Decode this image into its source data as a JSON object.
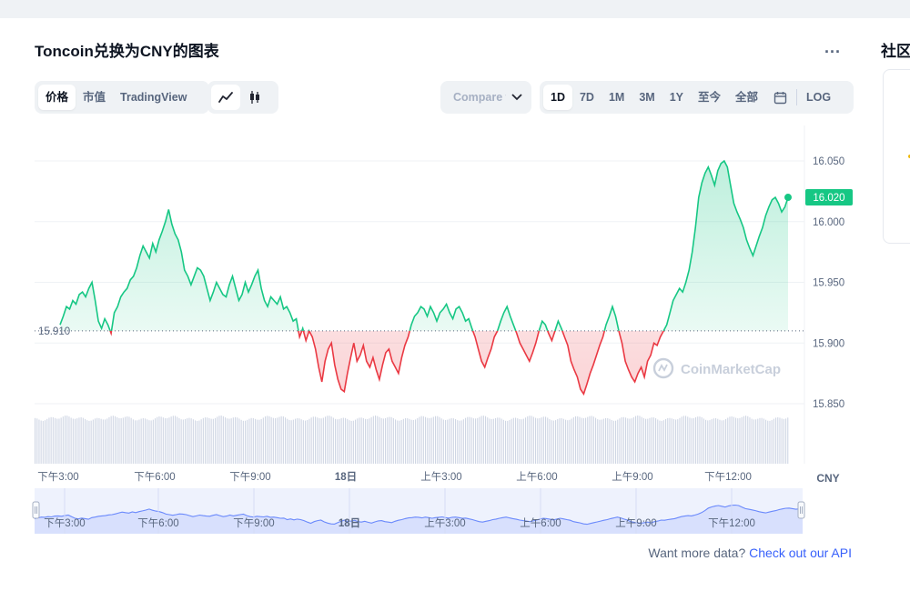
{
  "header": {
    "title": "Toncoin兑换为CNY的图表",
    "more": "...",
    "right_title": "社区"
  },
  "tabs": {
    "items": [
      {
        "label": "价格",
        "active": true
      },
      {
        "label": "市值",
        "active": false
      },
      {
        "label": "TradingView",
        "active": false
      }
    ],
    "chart_type_icons": [
      "line-chart-icon",
      "candlestick-icon"
    ]
  },
  "compare": {
    "label": "Compare w"
  },
  "ranges": {
    "items": [
      {
        "label": "1D",
        "active": true
      },
      {
        "label": "7D",
        "active": false
      },
      {
        "label": "1M",
        "active": false
      },
      {
        "label": "3M",
        "active": false
      },
      {
        "label": "1Y",
        "active": false
      },
      {
        "label": "至今",
        "active": false
      },
      {
        "label": "全部",
        "active": false
      }
    ],
    "calendar_icon": "calendar-icon",
    "log_label": "LOG"
  },
  "watermark": "CoinMarketCap",
  "footer": {
    "text": "Want more data?",
    "link": "Check out our API"
  },
  "colors": {
    "up": "#16c784",
    "down": "#ea3943",
    "volume": "#cfd6e4",
    "navigator": "#3861fb"
  },
  "chart_data": {
    "type": "line",
    "currency": "CNY",
    "reference_value": 15.91,
    "reference_label": "15.910",
    "current_value": 16.02,
    "current_label": "16.020",
    "ylim": [
      15.8,
      16.1
    ],
    "y_ticks": [
      "16.050",
      "16.000",
      "15.950",
      "15.900",
      "15.850"
    ],
    "x_ticks": [
      "下午3:00",
      "下午6:00",
      "下午9:00",
      "18日",
      "上午3:00",
      "上午6:00",
      "上午9:00",
      "下午12:00"
    ],
    "grid": "horizontal",
    "series": [
      {
        "values": [
          15.915,
          15.922,
          15.93,
          15.928,
          15.935,
          15.932,
          15.94,
          15.942,
          15.938,
          15.945,
          15.95,
          15.935,
          15.918,
          15.912,
          15.92,
          15.915,
          15.908,
          15.925,
          15.93,
          15.938,
          15.942,
          15.945,
          15.952,
          15.955,
          15.962,
          15.972,
          15.98,
          15.975,
          15.97,
          15.982,
          15.975,
          15.985,
          15.992,
          16.0,
          16.01,
          15.998,
          15.99,
          15.985,
          15.975,
          15.96,
          15.955,
          15.948,
          15.955,
          15.962,
          15.96,
          15.955,
          15.945,
          15.935,
          15.942,
          15.95,
          15.945,
          15.94,
          15.938,
          15.948,
          15.955,
          15.945,
          15.935,
          15.94,
          15.95,
          15.942,
          15.948,
          15.955,
          15.96,
          15.945,
          15.935,
          15.93,
          15.938,
          15.935,
          15.932,
          15.938,
          15.928,
          15.93,
          15.925,
          15.918,
          15.92,
          15.905,
          15.912,
          15.902,
          15.91,
          15.905,
          15.895,
          15.88,
          15.868,
          15.885,
          15.895,
          15.9,
          15.882,
          15.87,
          15.862,
          15.86,
          15.875,
          15.888,
          15.9,
          15.885,
          15.89,
          15.898,
          15.885,
          15.88,
          15.888,
          15.878,
          15.87,
          15.882,
          15.892,
          15.895,
          15.885,
          15.88,
          15.875,
          15.888,
          15.898,
          15.905,
          15.915,
          15.922,
          15.925,
          15.93,
          15.928,
          15.922,
          15.93,
          15.925,
          15.918,
          15.925,
          15.928,
          15.932,
          15.925,
          15.92,
          15.928,
          15.93,
          15.925,
          15.918,
          15.92,
          15.912,
          15.905,
          15.895,
          15.885,
          15.88,
          15.888,
          15.895,
          15.905,
          15.91,
          15.918,
          15.925,
          15.93,
          15.922,
          15.915,
          15.908,
          15.9,
          15.895,
          15.89,
          15.885,
          15.892,
          15.9,
          15.91,
          15.918,
          15.915,
          15.908,
          15.902,
          15.91,
          15.918,
          15.912,
          15.905,
          15.898,
          15.885,
          15.878,
          15.872,
          15.862,
          15.858,
          15.866,
          15.875,
          15.882,
          15.89,
          15.898,
          15.905,
          15.915,
          15.922,
          15.93,
          15.922,
          15.91,
          15.9,
          15.885,
          15.878,
          15.872,
          15.868,
          15.875,
          15.88,
          15.872,
          15.885,
          15.89,
          15.9,
          15.898,
          15.905,
          15.91,
          15.915,
          15.925,
          15.935,
          15.94,
          15.945,
          15.942,
          15.95,
          15.96,
          15.975,
          15.995,
          16.02,
          16.032,
          16.04,
          16.045,
          16.038,
          16.03,
          16.042,
          16.048,
          16.05,
          16.045,
          16.03,
          16.015,
          16.008,
          16.002,
          15.995,
          15.985,
          15.978,
          15.972,
          15.98,
          15.988,
          15.995,
          16.005,
          16.012,
          16.018,
          16.02,
          16.015,
          16.008,
          16.012,
          16.02
        ]
      }
    ]
  }
}
